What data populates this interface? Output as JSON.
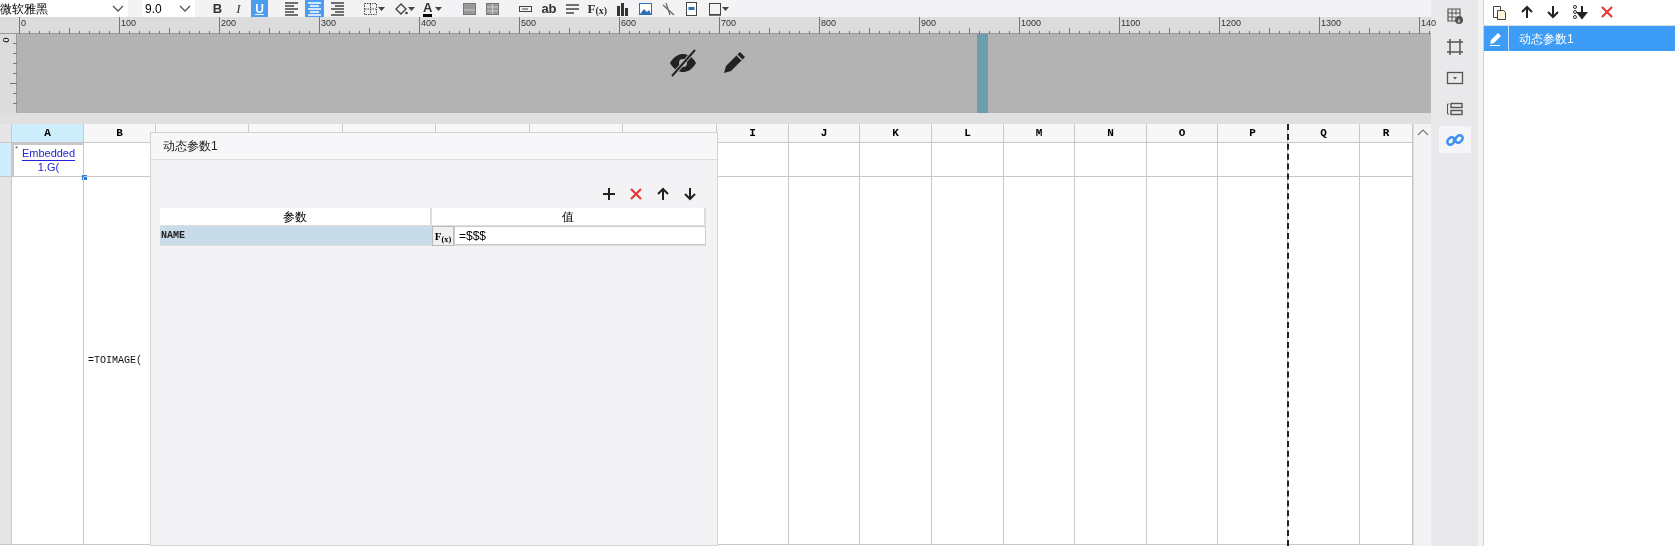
{
  "toolbar": {
    "font": "微软雅黑",
    "size": "9.0",
    "items": [
      {
        "kind": "bold",
        "label": "B",
        "selected": false
      },
      {
        "kind": "italic",
        "label": "I",
        "selected": false
      },
      {
        "kind": "underline",
        "label": "U",
        "selected": true
      },
      {
        "kind": "align-left",
        "selected": false
      },
      {
        "kind": "align-center",
        "selected": true
      },
      {
        "kind": "align-right",
        "selected": false
      },
      {
        "kind": "border",
        "selected": false
      },
      {
        "kind": "fill",
        "selected": false
      },
      {
        "kind": "font-color",
        "label": "A",
        "selected": false
      },
      {
        "kind": "merge",
        "selected": false
      },
      {
        "kind": "unmerge",
        "selected": false
      },
      {
        "kind": "field",
        "selected": false
      },
      {
        "kind": "text",
        "label": "ab",
        "selected": false
      },
      {
        "kind": "paragraph",
        "selected": false
      },
      {
        "kind": "formula",
        "label": "F$_{(x)}$",
        "selected": false
      },
      {
        "kind": "chart",
        "selected": false
      },
      {
        "kind": "image",
        "selected": false
      },
      {
        "kind": "slash",
        "selected": false
      },
      {
        "kind": "report",
        "selected": false
      },
      {
        "kind": "frame",
        "selected": false
      }
    ]
  },
  "ruler": {
    "labels": [
      "0",
      "100",
      "200",
      "300",
      "400",
      "500",
      "600",
      "700",
      "800",
      "900",
      "1000",
      "1100",
      "1200",
      "1300",
      "140"
    ],
    "vertical_label": "0"
  },
  "sheet": {
    "columns": [
      {
        "letter": "A",
        "selected": true
      },
      {
        "letter": "B",
        "selected": false
      },
      {
        "letter": "I",
        "selected": false
      },
      {
        "letter": "J",
        "selected": false
      },
      {
        "letter": "K",
        "selected": false
      },
      {
        "letter": "L",
        "selected": false
      },
      {
        "letter": "M",
        "selected": false
      },
      {
        "letter": "N",
        "selected": false
      },
      {
        "letter": "O",
        "selected": false
      },
      {
        "letter": "P",
        "selected": false
      },
      {
        "letter": "Q",
        "selected": false
      },
      {
        "letter": "R",
        "selected": false
      }
    ],
    "cell_a1": {
      "marker": "*",
      "lines": [
        "Embedded",
        "1.G("
      ]
    },
    "cell_b2": "=TOIMAGE("
  },
  "dialog": {
    "title": "动态参数1",
    "actions": [
      {
        "kind": "add"
      },
      {
        "kind": "delete"
      },
      {
        "kind": "up"
      },
      {
        "kind": "down"
      }
    ],
    "columns": [
      "参数",
      "值"
    ],
    "rows": [
      {
        "name": "NAME",
        "formula_button": "F$_{(x)}$",
        "value": "=$$$"
      }
    ]
  },
  "side_tabs": [
    {
      "kind": "cell-info",
      "selected": false
    },
    {
      "kind": "frame",
      "selected": false
    },
    {
      "kind": "dropdown",
      "selected": false
    },
    {
      "kind": "widget",
      "selected": false
    },
    {
      "kind": "link",
      "selected": true
    }
  ],
  "panel": {
    "actions": [
      {
        "kind": "copy"
      },
      {
        "kind": "up"
      },
      {
        "kind": "down"
      },
      {
        "kind": "bottom"
      },
      {
        "kind": "delete"
      }
    ],
    "items": [
      {
        "label": "动态参数1",
        "selected": true
      }
    ]
  }
}
